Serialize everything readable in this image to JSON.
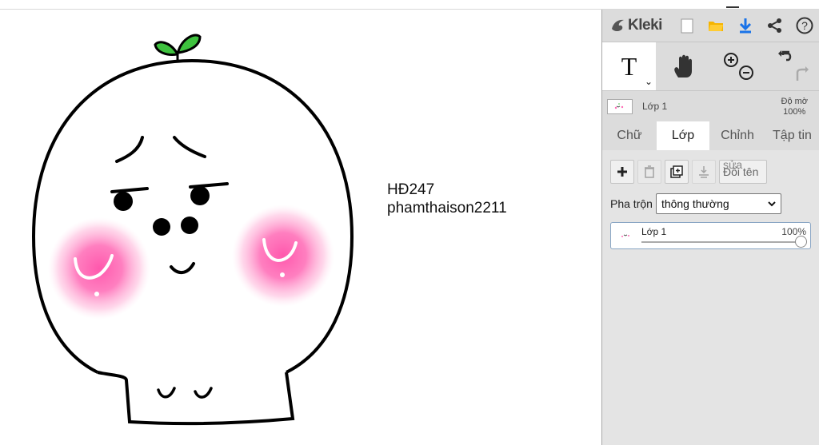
{
  "canvas": {
    "text_line1": "HĐ247",
    "text_line2": "phamthaison2211"
  },
  "app": {
    "logo_text": "Kleki",
    "header_icons": [
      "new-image-icon",
      "open-folder-icon",
      "download-icon",
      "share-icon",
      "help-icon"
    ],
    "tools": [
      "text-tool",
      "hand-tool",
      "zoom-tool",
      "undo-redo"
    ],
    "active_tool_letter": "T"
  },
  "layer_bar": {
    "layer_name": "Lớp 1",
    "opacity_label": "Độ mờ",
    "opacity_value": "100%"
  },
  "tabs": [
    {
      "label": "Chữ",
      "active": false
    },
    {
      "label": "Lớp",
      "active": true
    },
    {
      "label": "Chỉnh",
      "active": false
    },
    {
      "label": "Tập tin",
      "active": false
    }
  ],
  "layers_panel": {
    "rename_ghost": "sửa",
    "rename_label": "Đổi tên",
    "blend_label": "Pha trộn",
    "blend_value": "thông thường",
    "layer": {
      "name": "Lớp 1",
      "opacity": "100%",
      "opacity_fraction": 1.0
    }
  },
  "colors": {
    "panel_bg": "#dcdcdc",
    "accent_blue": "#1a73e8",
    "folder_yellow": "#f5b400",
    "sprout_green": "#3ec23e",
    "blush_pink": "#ff4fa8"
  }
}
